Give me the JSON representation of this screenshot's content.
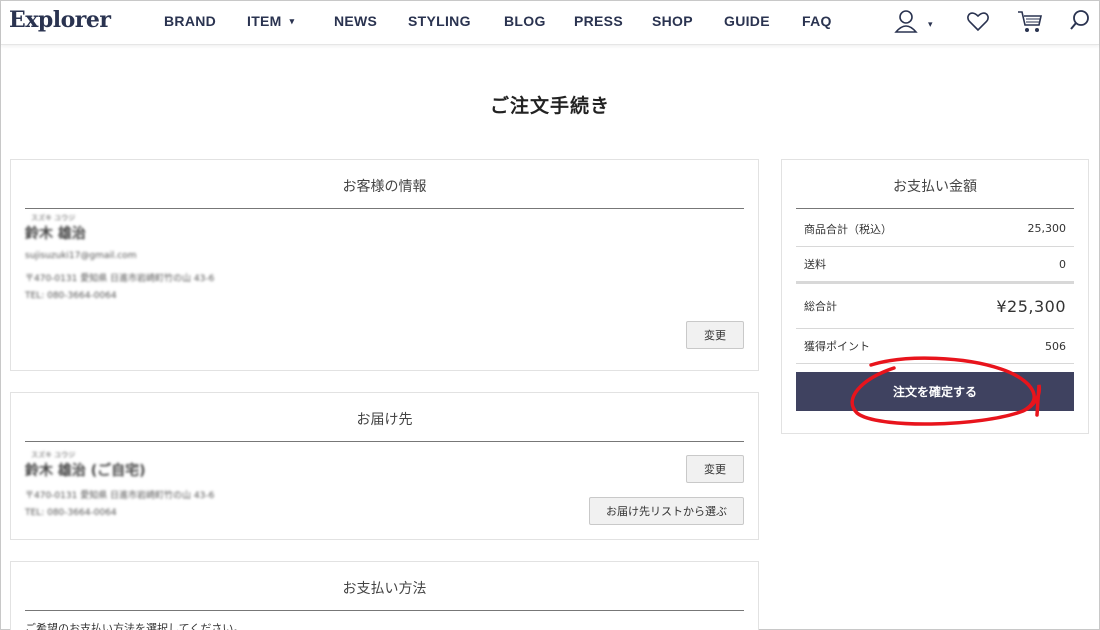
{
  "header": {
    "logo": "Explorer",
    "nav": [
      {
        "label": "BRAND"
      },
      {
        "label": "ITEM",
        "caret": "▾"
      },
      {
        "label": "NEWS"
      },
      {
        "label": "STYLING"
      },
      {
        "label": "BLOG"
      },
      {
        "label": "PRESS"
      },
      {
        "label": "SHOP"
      },
      {
        "label": "GUIDE"
      },
      {
        "label": "FAQ"
      }
    ],
    "account_caret": "▾",
    "icons": [
      "user-icon",
      "heart-icon",
      "cart-icon",
      "search-icon"
    ]
  },
  "page": {
    "title": "ご注文手続き"
  },
  "customer": {
    "title": "お客様の情報",
    "kana": "スズキ ユウジ",
    "name": "鈴木 雄治",
    "email": "sujisuzuki17@gmail.com",
    "address": "〒470-0131 愛知県 日進市岩崎町竹の山 43-6",
    "tel": "TEL: 080-3664-0064",
    "change_label": "変更"
  },
  "delivery": {
    "title": "お届け先",
    "kana": "スズキ ユウジ",
    "name": "鈴木 雄治 (ご自宅)",
    "address": "〒470-0131 愛知県 日進市岩崎町竹の山 43-6",
    "tel": "TEL: 080-3664-0064",
    "change_label": "変更",
    "choose_label": "お届け先リストから選ぶ"
  },
  "payment_method": {
    "title": "お支払い方法",
    "instruction": "ご希望のお支払い方法を選択してください。"
  },
  "summary": {
    "title": "お支払い金額",
    "subtotal_label": "商品合計（税込）",
    "subtotal_value": "25,300",
    "shipping_label": "送料",
    "shipping_value": "0",
    "total_label": "総合計",
    "total_value": "¥25,300",
    "points_label": "獲得ポイント",
    "points_value": "506",
    "confirm_label": "注文を確定する"
  },
  "colors": {
    "navy": "#2a3350",
    "confirm_bg": "#3f4260",
    "annotation": "#e8141c"
  }
}
